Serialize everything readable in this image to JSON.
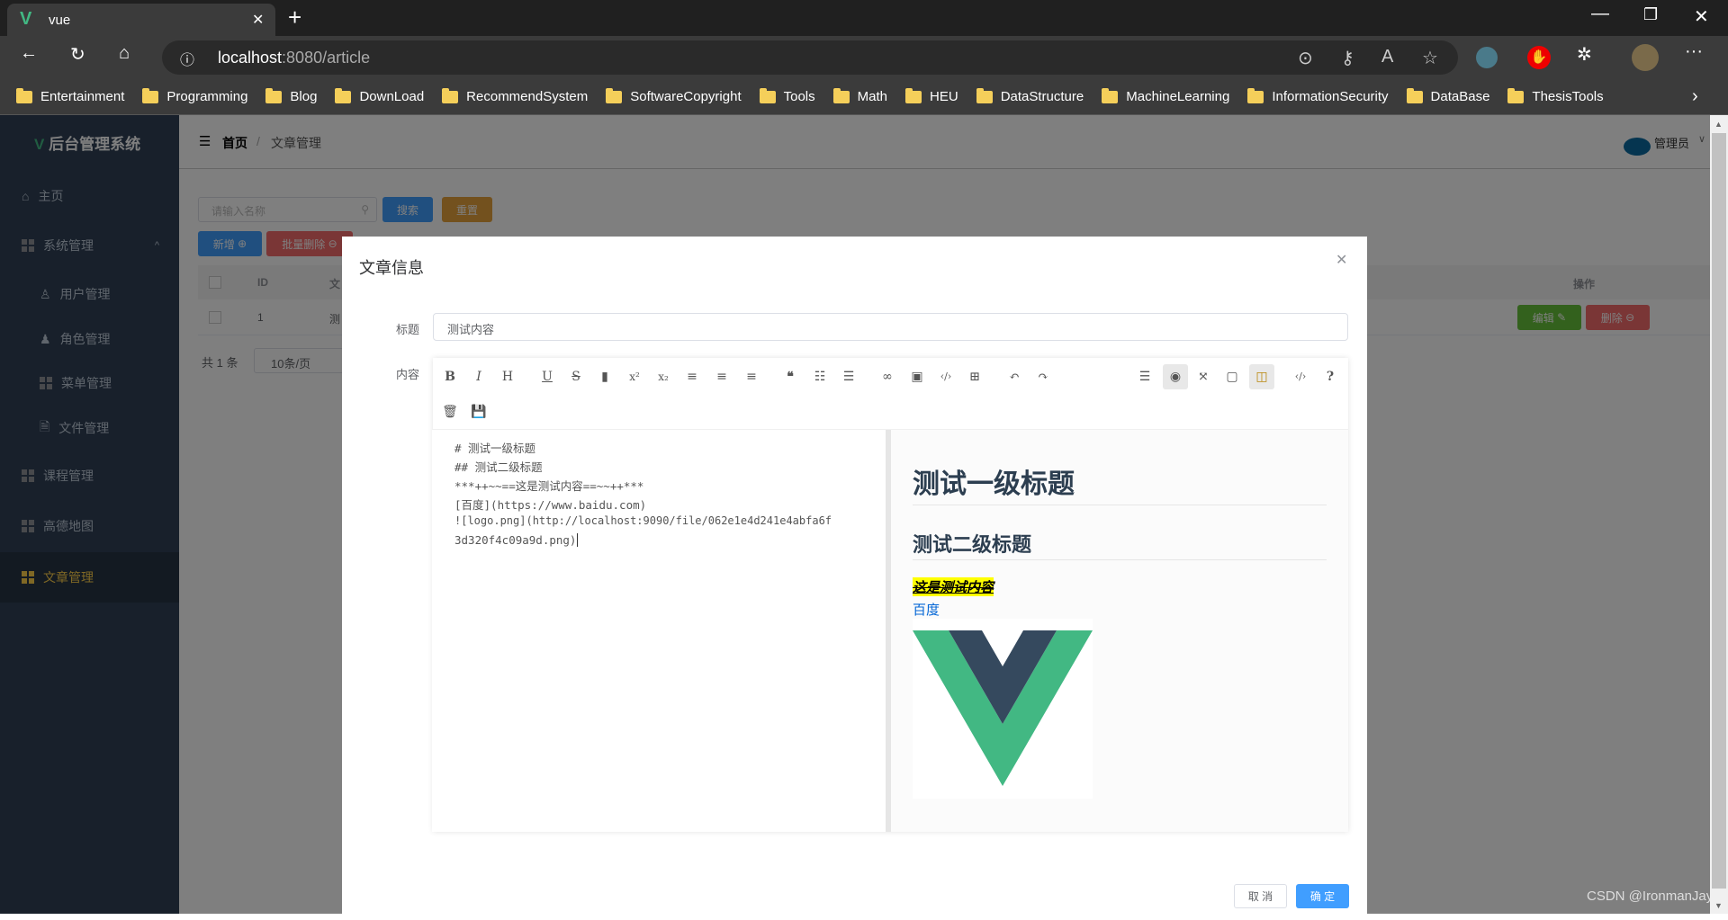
{
  "browser": {
    "tab_title": "vue",
    "url_host": "localhost",
    "url_rest": ":8080/article",
    "bookmarks": [
      "Entertainment",
      "Programming",
      "Blog",
      "DownLoad",
      "RecommendSystem",
      "SoftwareCopyright",
      "Tools",
      "Math",
      "HEU",
      "DataStructure",
      "MachineLearning",
      "InformationSecurity",
      "DataBase",
      "ThesisTools"
    ]
  },
  "sidebar": {
    "logo": "后台管理系统",
    "items": [
      {
        "label": "主页",
        "icon": "home-icon"
      },
      {
        "label": "系统管理",
        "icon": "grid-icon"
      },
      {
        "label": "用户管理",
        "icon": "user-icon"
      },
      {
        "label": "角色管理",
        "icon": "user-filled-icon"
      },
      {
        "label": "菜单管理",
        "icon": "menu-icon"
      },
      {
        "label": "文件管理",
        "icon": "document-icon"
      },
      {
        "label": "课程管理",
        "icon": "grid-icon"
      },
      {
        "label": "高德地图",
        "icon": "grid-icon"
      },
      {
        "label": "文章管理",
        "icon": "grid-icon",
        "active": true
      }
    ]
  },
  "header": {
    "breadcrumb": [
      "首页",
      "文章管理"
    ],
    "user": "管理员"
  },
  "toolbar": {
    "search_placeholder": "请输入名称",
    "search": "搜索",
    "reset": "重置",
    "add": "新增",
    "batch_delete": "批量删除"
  },
  "table": {
    "columns": [
      "ID",
      "文",
      "操作"
    ],
    "rows": [
      {
        "id": "1",
        "title": "测",
        "edit": "编辑",
        "delete": "删除"
      }
    ]
  },
  "pagination": {
    "total": "共 1 条",
    "page_size": "10条/页"
  },
  "dialog": {
    "title": "文章信息",
    "title_label": "标题",
    "title_value": "测试内容",
    "content_label": "内容",
    "cancel": "取 消",
    "confirm": "确 定",
    "editor_lines": [
      "# 测试一级标题",
      "## 测试二级标题",
      "***++~~==这是测试内容==~~++***",
      "[百度](https://www.baidu.com)",
      "![logo.png](http://localhost:9090/file/062e1e4d241e4abfa6f",
      "3d320f4c09a9d.png)"
    ],
    "preview": {
      "h1": "测试一级标题",
      "h2": "测试二级标题",
      "emphasis": "这是测试内容",
      "link": "百度"
    }
  },
  "watermark": "CSDN @IronmanJay",
  "colors": {
    "primary": "#409eff",
    "danger": "#f56c6c",
    "warning": "#e6a23c",
    "success": "#67c23a",
    "vue_green": "#42b883",
    "vue_dark": "#35495e"
  }
}
